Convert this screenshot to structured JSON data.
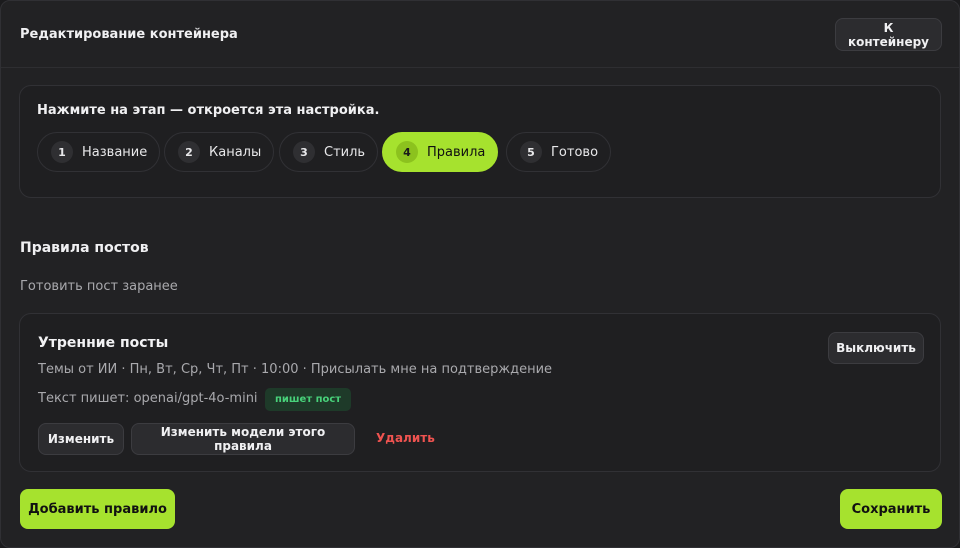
{
  "header": {
    "title": "Редактирование контейнера",
    "back_label": "К контейнеру"
  },
  "steps": {
    "hint": "Нажмите на этап — откроется эта настройка.",
    "items": [
      {
        "num": "1",
        "label": "Название",
        "active": false
      },
      {
        "num": "2",
        "label": "Каналы",
        "active": false
      },
      {
        "num": "3",
        "label": "Стиль",
        "active": false
      },
      {
        "num": "4",
        "label": "Правила",
        "active": true
      },
      {
        "num": "5",
        "label": "Готово",
        "active": false
      }
    ]
  },
  "section": {
    "title": "Правила постов",
    "subtitle": "Готовить пост заранее"
  },
  "rule": {
    "title": "Утренние посты",
    "description": "Темы от ИИ · Пн, Вт, Ср, Чт, Пт · 10:00 · Присылать мне на подтверждение",
    "model_text": "Текст пишет: openai/gpt-4o-mini",
    "badge": "пишет пост",
    "disable_label": "Выключить",
    "edit_label": "Изменить",
    "models_label": "Изменить модели этого правила",
    "delete_label": "Удалить"
  },
  "footer": {
    "add_label": "Добавить правило",
    "save_label": "Сохранить"
  },
  "colors": {
    "accent": "#a6e22e",
    "danger": "#ef5350",
    "badge_text": "#48d17a"
  }
}
